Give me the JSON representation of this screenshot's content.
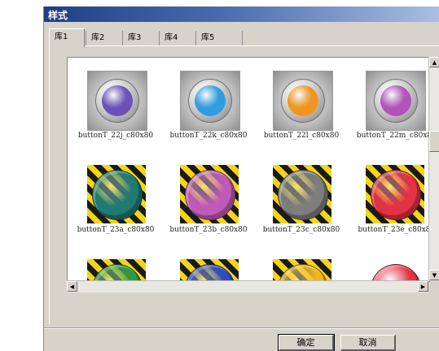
{
  "window": {
    "title": "样式"
  },
  "tabs": [
    {
      "label": "库1",
      "active": true
    },
    {
      "label": "库2",
      "active": false
    },
    {
      "label": "库3",
      "active": false
    },
    {
      "label": "库4",
      "active": false
    },
    {
      "label": "库5",
      "active": false
    }
  ],
  "gallery": {
    "items": [
      {
        "label": "buttonT_22j_c80x80",
        "style": "metal",
        "color": "#6a52b8"
      },
      {
        "label": "buttonT_22k_c80x80",
        "style": "metal",
        "color": "#2f9de0"
      },
      {
        "label": "buttonT_22l_c80x80",
        "style": "metal",
        "color": "#f0951e"
      },
      {
        "label": "buttonT_22m_c80x8",
        "style": "metal",
        "color": "#b154b8"
      },
      {
        "label": "buttonT_23a_c80x80",
        "style": "hazard",
        "color": "#1f7a72"
      },
      {
        "label": "buttonT_23b_c80x80",
        "style": "hazard",
        "color": "#c05ab8"
      },
      {
        "label": "buttonT_23c_c80x80",
        "style": "hazard",
        "color": "#7d7d7d"
      },
      {
        "label": "buttonT_23e_c80x8",
        "style": "hazard",
        "color": "#e23244"
      },
      {
        "label": "",
        "style": "hazard",
        "color": "#2e9a3e"
      },
      {
        "label": "",
        "style": "hazard",
        "color": "#2c4cc0"
      },
      {
        "label": "",
        "style": "hazard",
        "color": "#f2b81a"
      },
      {
        "label": "",
        "style": "plain",
        "color": "#e23244"
      }
    ]
  },
  "scrollbars": {
    "vertical": {
      "up_icon": "arrow-up-icon",
      "down_icon": "arrow-down-icon",
      "position": 0.35
    },
    "horizontal": {
      "left_icon": "arrow-left-icon",
      "right_icon": "arrow-right-icon",
      "position": 1.0
    }
  },
  "buttons": {
    "ok": "确定",
    "cancel": "取消"
  }
}
